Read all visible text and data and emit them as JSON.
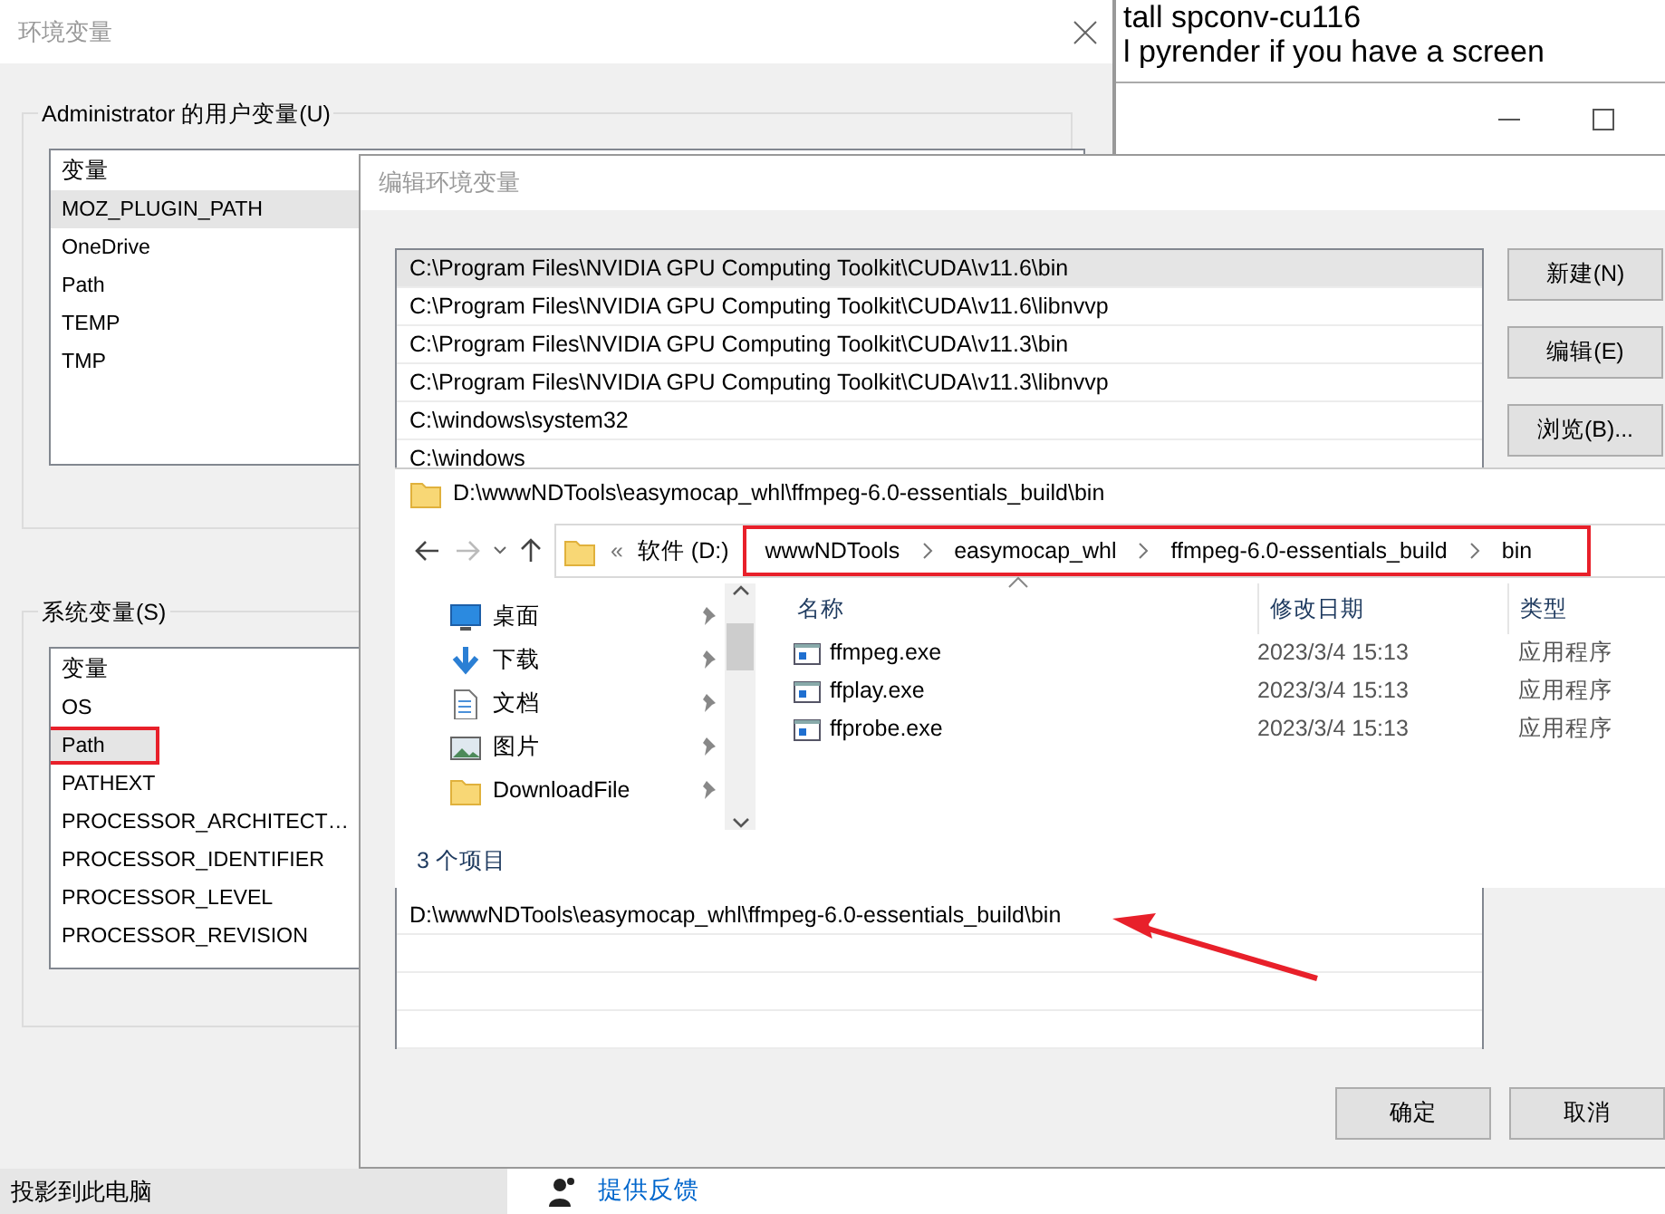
{
  "background_window": {
    "lines": [
      "tall spconv-cu116",
      "l pyrender if you have a screen"
    ]
  },
  "env_window": {
    "title": "环境变量",
    "user_group": {
      "label": "Administrator 的用户变量(U)",
      "column": "变量",
      "items": [
        {
          "name": "MOZ_PLUGIN_PATH",
          "selected": true
        },
        {
          "name": "OneDrive",
          "selected": false
        },
        {
          "name": "Path",
          "selected": false
        },
        {
          "name": "TEMP",
          "selected": false
        },
        {
          "name": "TMP",
          "selected": false
        }
      ]
    },
    "system_group": {
      "label": "系统变量(S)",
      "column": "变量",
      "items": [
        {
          "name": "OS",
          "selected": false,
          "annotated": false
        },
        {
          "name": "Path",
          "selected": true,
          "annotated": true
        },
        {
          "name": "PATHEXT",
          "selected": false,
          "annotated": false
        },
        {
          "name": "PROCESSOR_ARCHITECT…",
          "selected": false,
          "annotated": false
        },
        {
          "name": "PROCESSOR_IDENTIFIER",
          "selected": false,
          "annotated": false
        },
        {
          "name": "PROCESSOR_LEVEL",
          "selected": false,
          "annotated": false
        },
        {
          "name": "PROCESSOR_REVISION",
          "selected": false,
          "annotated": false
        }
      ]
    }
  },
  "edit_dialog": {
    "title": "编辑环境变量",
    "entries": [
      {
        "text": "C:\\Program Files\\NVIDIA GPU Computing Toolkit\\CUDA\\v11.6\\bin",
        "selected": true
      },
      {
        "text": "C:\\Program Files\\NVIDIA GPU Computing Toolkit\\CUDA\\v11.6\\libnvvp",
        "selected": false
      },
      {
        "text": "C:\\Program Files\\NVIDIA GPU Computing Toolkit\\CUDA\\v11.3\\bin",
        "selected": false
      },
      {
        "text": "C:\\Program Files\\NVIDIA GPU Computing Toolkit\\CUDA\\v11.3\\libnvvp",
        "selected": false
      },
      {
        "text": "C:\\windows\\system32",
        "selected": false
      },
      {
        "text": "C:\\windows",
        "selected": false
      }
    ],
    "editing_entry": "D:\\wwwNDTools\\easymocap_whl\\ffmpeg-6.0-essentials_build\\bin",
    "side_buttons": [
      "新建(N)",
      "编辑(E)",
      "浏览(B)..."
    ],
    "footer_buttons": [
      "确定",
      "取消"
    ]
  },
  "file_window": {
    "title": "D:\\wwwNDTools\\easymocap_whl\\ffmpeg-6.0-essentials_build\\bin",
    "overflow": "«",
    "drive": "软件 (D:)",
    "breadcrumbs": [
      "wwwNDTools",
      "easymocap_whl",
      "ffmpeg-6.0-essentials_build",
      "bin"
    ],
    "breadcrumbs_annotated": true,
    "nav_items": [
      {
        "label": "桌面",
        "kind": "desktop"
      },
      {
        "label": "下载",
        "kind": "download"
      },
      {
        "label": "文档",
        "kind": "document"
      },
      {
        "label": "图片",
        "kind": "pictures"
      },
      {
        "label": "DownloadFile",
        "kind": "folder"
      }
    ],
    "columns": [
      "名称",
      "修改日期",
      "类型"
    ],
    "files": [
      {
        "name": "ffmpeg.exe",
        "modified": "2023/3/4 15:13",
        "type": "应用程序"
      },
      {
        "name": "ffplay.exe",
        "modified": "2023/3/4 15:13",
        "type": "应用程序"
      },
      {
        "name": "ffprobe.exe",
        "modified": "2023/3/4 15:13",
        "type": "应用程序"
      }
    ],
    "status": "3 个项目"
  },
  "bottom_strip": {
    "left_text": "投影到此电脑",
    "link": "提供反馈"
  }
}
